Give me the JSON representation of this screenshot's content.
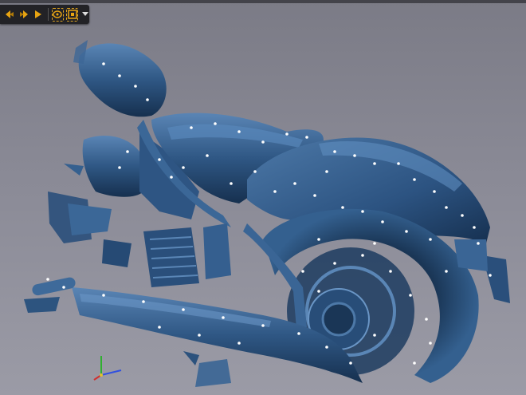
{
  "app": {
    "viewport_label": "",
    "background_top": "#7b7b86",
    "background_bottom": "#9b9ba6"
  },
  "toolbar": {
    "accent": "#e8a412",
    "buttons": [
      {
        "name": "rotate-left-icon",
        "active": false
      },
      {
        "name": "rotate-right-icon",
        "active": false
      },
      {
        "name": "play-icon",
        "active": false
      },
      {
        "name": "lasso-select-icon",
        "active": true
      },
      {
        "name": "rect-select-icon",
        "active": true
      }
    ],
    "dropdown_icon": "chevron-down-icon"
  },
  "model": {
    "mesh_color": "#2f5784",
    "mesh_highlight": "#5a85b5",
    "mesh_shadow": "#16304f",
    "marker_color": "#ffffff"
  },
  "axis_gizmo": {
    "x_color": "#d03030",
    "y_color": "#30b030",
    "z_color": "#3050e0"
  }
}
